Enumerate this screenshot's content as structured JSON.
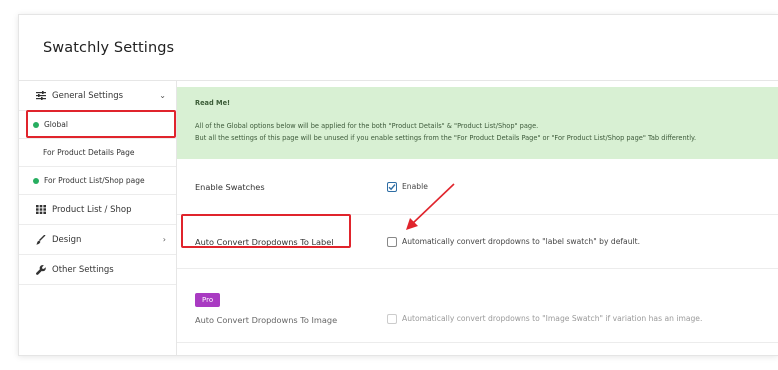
{
  "header": {
    "title": "Swatchly Settings"
  },
  "sidebar": {
    "general": {
      "label": "General Settings",
      "icon": "sliders-icon"
    },
    "sub_items": [
      {
        "label": "Global",
        "active": true
      },
      {
        "label": "For Product Details Page"
      },
      {
        "label": "For Product List/Shop page"
      }
    ],
    "items": [
      {
        "label": "Product List / Shop",
        "icon": "grid-icon"
      },
      {
        "label": "Design",
        "icon": "brush-icon"
      },
      {
        "label": "Other Settings",
        "icon": "wrench-icon"
      }
    ]
  },
  "notice": {
    "title": "Read Me!",
    "line1": "All of the Global options below will be applied for the both \"Product Details\" & \"Product List/Shop\" page.",
    "line2": "But all the settings of this page will be unused if you enable settings from the \"For Product Details Page\" or \"For Product List/Shop page\" Tab differently."
  },
  "settings": {
    "enable_swatches": {
      "label": "Enable Swatches",
      "option": "Enable",
      "checked": true
    },
    "auto_convert_label": {
      "label": "Auto Convert Dropdowns To Label",
      "option": "Automatically convert dropdowns to \"label swatch\" by default.",
      "checked": false
    },
    "auto_convert_image": {
      "badge": "Pro",
      "label": "Auto Convert Dropdowns To Image",
      "option": "Automatically convert dropdowns to \"Image Swatch\" if variation has an image.",
      "checked": false
    }
  },
  "colors": {
    "accent_green": "#27ae60",
    "notice_bg": "#d8f0d3",
    "pro_badge": "#a93bc2",
    "highlight": "#e0242c"
  }
}
